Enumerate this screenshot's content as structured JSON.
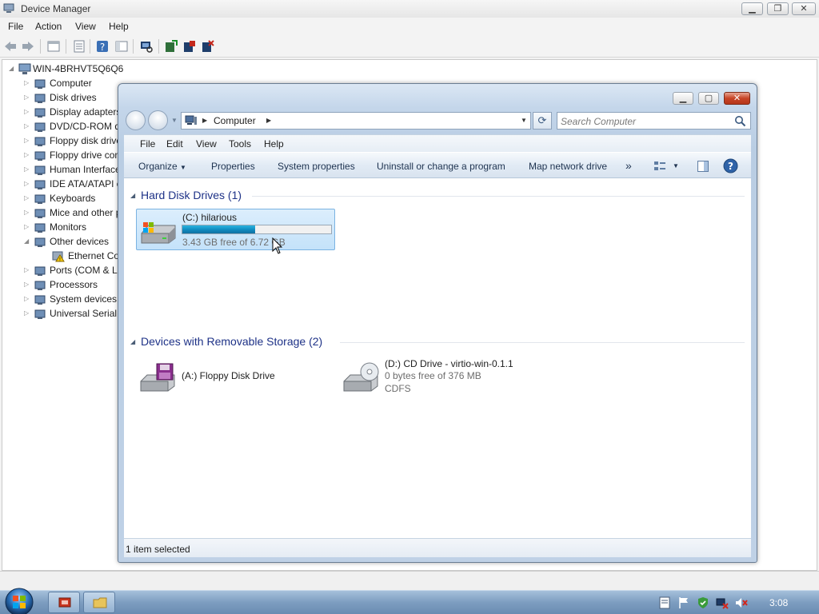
{
  "device_manager": {
    "title": "Device Manager",
    "menu": [
      "File",
      "Action",
      "View",
      "Help"
    ],
    "root_node": "WIN-4BRHVT5Q6Q6",
    "tree": [
      {
        "label": "Computer",
        "icon": "computer-icon",
        "expander": "▷"
      },
      {
        "label": "Disk drives",
        "icon": "disk-drive-icon",
        "expander": "▷"
      },
      {
        "label": "Display adapters",
        "icon": "display-adapter-icon",
        "expander": "▷"
      },
      {
        "label": "DVD/CD-ROM drives",
        "icon": "cd-drive-icon",
        "expander": "▷"
      },
      {
        "label": "Floppy disk drives",
        "icon": "floppy-icon",
        "expander": "▷"
      },
      {
        "label": "Floppy drive controllers",
        "icon": "floppy-controller-icon",
        "expander": "▷"
      },
      {
        "label": "Human Interface Devices",
        "icon": "hid-icon",
        "expander": "▷"
      },
      {
        "label": "IDE ATA/ATAPI controllers",
        "icon": "ide-icon",
        "expander": "▷"
      },
      {
        "label": "Keyboards",
        "icon": "keyboard-icon",
        "expander": "▷"
      },
      {
        "label": "Mice and other pointing devices",
        "icon": "mouse-icon",
        "expander": "▷"
      },
      {
        "label": "Monitors",
        "icon": "monitor-icon",
        "expander": "▷"
      },
      {
        "label": "Other devices",
        "icon": "other-devices-icon",
        "expander": "◢"
      },
      {
        "label": "Ethernet Controller",
        "icon": "warning-device-icon",
        "expander": "",
        "child": true
      },
      {
        "label": "Ports (COM & LPT)",
        "icon": "port-icon",
        "expander": "▷"
      },
      {
        "label": "Processors",
        "icon": "processor-icon",
        "expander": "▷"
      },
      {
        "label": "System devices",
        "icon": "system-devices-icon",
        "expander": "▷"
      },
      {
        "label": "Universal Serial Bus controllers",
        "icon": "usb-icon",
        "expander": "▷"
      }
    ]
  },
  "explorer": {
    "breadcrumb": "Computer",
    "search_placeholder": "Search Computer",
    "menu": [
      "File",
      "Edit",
      "View",
      "Tools",
      "Help"
    ],
    "commands": {
      "organize": "Organize",
      "properties": "Properties",
      "system_properties": "System properties",
      "uninstall": "Uninstall or change a program",
      "map_network": "Map network drive",
      "overflow": "»"
    },
    "groups": {
      "hard_disk": "Hard Disk Drives (1)",
      "removable": "Devices with Removable Storage (2)"
    },
    "drives": {
      "c": {
        "name": "(C:) hilarious",
        "free": "3.43 GB free of 6.72 GB",
        "used_fraction": 0.49
      },
      "a": {
        "name": "(A:) Floppy Disk Drive"
      },
      "d": {
        "name": "(D:) CD Drive - virtio-win-0.1.1",
        "free": "0 bytes free of 376 MB",
        "fs": "CDFS"
      }
    },
    "status": "1 item selected"
  },
  "taskbar": {
    "clock": "3:08"
  },
  "colors": {
    "selection": "#c4e2fa",
    "usage_bar": "#0f8abf",
    "group_header": "#1e3287"
  }
}
